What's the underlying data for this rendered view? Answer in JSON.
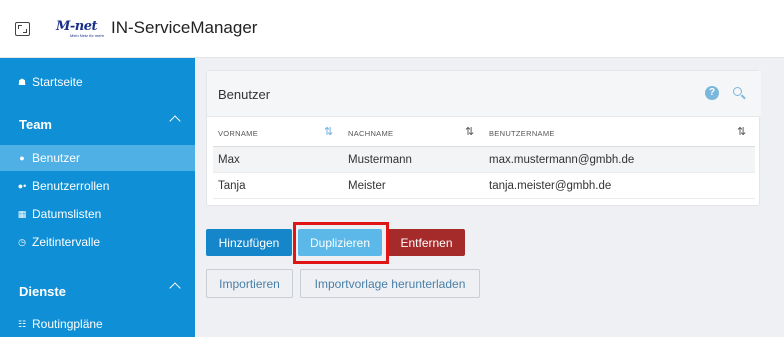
{
  "app": {
    "title": "IN-ServiceManager",
    "logo_text": "M-net",
    "logo_subtext": "Mein Netz für mehr"
  },
  "sidebar": {
    "startseite": "Startseite",
    "team_header": "Team",
    "team_items": [
      {
        "label": "Benutzer",
        "icon": "user-icon"
      },
      {
        "label": "Benutzerrollen",
        "icon": "users-icon"
      },
      {
        "label": "Datumslisten",
        "icon": "calendar-icon"
      },
      {
        "label": "Zeitintervalle",
        "icon": "clock-icon"
      }
    ],
    "dienste_header": "Dienste",
    "dienste_items": [
      {
        "label": "Routingpläne",
        "icon": "sitemap-icon"
      }
    ]
  },
  "card": {
    "title": "Benutzer",
    "help_glyph": "?",
    "columns": [
      "VORNAME",
      "NACHNAME",
      "BENUTZERNAME"
    ],
    "rows": [
      [
        "Max",
        "Mustermann",
        "max.mustermann@gmbh.de"
      ],
      [
        "Tanja",
        "Meister",
        "tanja.meister@gmbh.de"
      ]
    ]
  },
  "actions": {
    "add": "Hinzufügen",
    "duplicate": "Duplizieren",
    "remove": "Entfernen",
    "import": "Importieren",
    "download_template": "Importvorlage herunterladen"
  },
  "colors": {
    "sidebar": "#0f8fd6",
    "active_item": "#4fb0e6",
    "primary": "#1586c9",
    "danger": "#a52a2a",
    "highlight": "#e01515"
  }
}
